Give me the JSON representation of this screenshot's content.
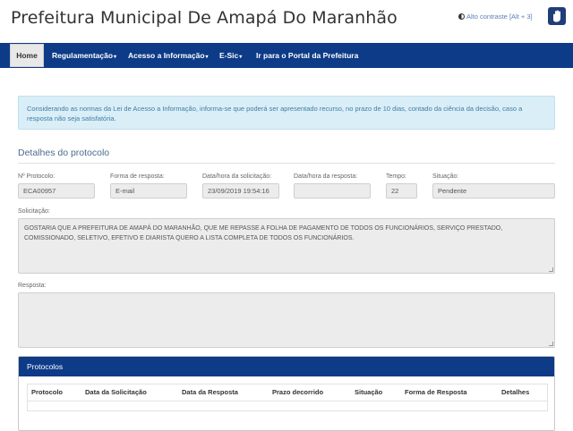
{
  "header": {
    "site_title": "Prefeitura Municipal De Amapá Do Maranhão",
    "contrast_label": "Alto contraste [Alt + 3]"
  },
  "nav": {
    "items": [
      {
        "label": "Home",
        "has_caret": false,
        "active": true
      },
      {
        "label": "Regulamentação",
        "has_caret": true,
        "active": false
      },
      {
        "label": "Acesso a Informação",
        "has_caret": true,
        "active": false
      },
      {
        "label": "E-Sic",
        "has_caret": true,
        "active": false
      },
      {
        "label": "Ir para o Portal da Prefeitura",
        "has_caret": false,
        "active": false
      }
    ],
    "caret": "▾"
  },
  "alert": {
    "text": "Considerando as normas da Lei de Acesso a Informação, informa-se que poderá ser apresentado recurso, no prazo de 10 dias, contado da ciência da decisão, caso a resposta não seja satisfatória."
  },
  "details": {
    "title": "Detalhes do protocolo",
    "fields": {
      "protocolo": {
        "label": "Nº Protocolo:",
        "value": "ECA00957"
      },
      "forma": {
        "label": "Forma de resposta:",
        "value": "E-mail"
      },
      "data_solic": {
        "label": "Data/hora da solicitação:",
        "value": "23/09/2019 19:54:16"
      },
      "data_resp": {
        "label": "Data/hora da resposta:",
        "value": ""
      },
      "tempo": {
        "label": "Tempo:",
        "value": "22"
      },
      "situacao": {
        "label": "Situação:",
        "value": "Pendente"
      }
    },
    "solicitacao": {
      "label": "Solicitação:",
      "value": "GOSTARIA QUE  A PREFEITURA DE AMAPÁ DO MARANHÃO, QUE ME REPASSE A FOLHA DE PAGAMENTO DE TODOS OS FUNCIONÁRIOS, SERVIÇO PRESTADO, COMISSIONADO, SELETIVO, EFETIVO E DIARISTA QUERO A LISTA COMPLETA DE TODOS OS FUNCIONÁRIOS."
    },
    "resposta": {
      "label": "Resposta:",
      "value": ""
    }
  },
  "protocolos": {
    "title": "Protocolos",
    "columns": [
      "Protocolo",
      "Data da Solicitação",
      "Data da Resposta",
      "Prazo decorrido",
      "Situação",
      "Forma de Resposta",
      "Detalhes"
    ]
  },
  "colors": {
    "nav_blue": "#0d3b87",
    "alert_bg": "#d9eef7",
    "alert_text": "#3f7ea5"
  }
}
